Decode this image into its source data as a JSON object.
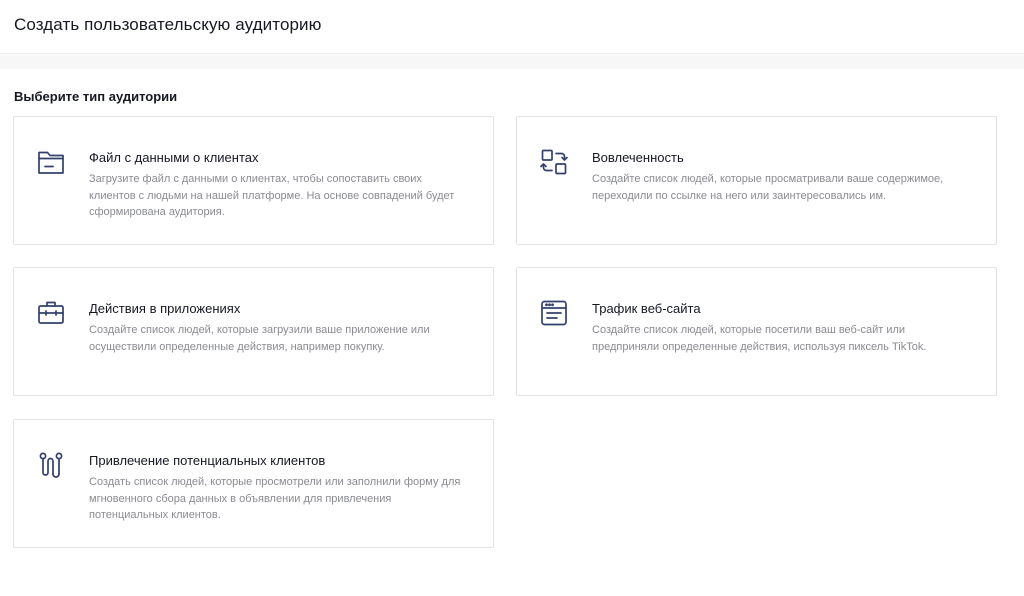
{
  "header": {
    "title": "Создать пользовательскую аудиторию"
  },
  "section": {
    "label": "Выберите тип аудитории"
  },
  "cards": [
    {
      "icon": "folder-icon",
      "title": "Файл с данными о клиентах",
      "description": "Загрузите файл с данными о клиентах, чтобы сопоставить своих клиентов с людьми на нашей платформе. На основе совпадений будет сформирована аудитория."
    },
    {
      "icon": "engagement-icon",
      "title": "Вовлеченность",
      "description": "Создайте список людей, которые просматривали ваше содержимое, переходили по ссылке на него или заинтересовались им."
    },
    {
      "icon": "briefcase-icon",
      "title": "Действия в приложениях",
      "description": "Создайте список людей, которые загрузили ваше приложение или осуществили определенные действия, например покупку."
    },
    {
      "icon": "browser-window-icon",
      "title": "Трафик веб-сайта",
      "description": "Создайте список людей, которые посетили ваш веб-сайт или предприняли определенные действия, используя пиксель TikTok."
    },
    {
      "icon": "lead-path-icon",
      "title": "Привлечение потенциальных клиентов",
      "description": "Создать список людей, которые просмотрели или заполнили форму для мгновенного сбора данных в объявлении для привлечения потенциальных клиентов."
    }
  ],
  "colors": {
    "icon_stroke": "#33406b",
    "title_text": "#161823",
    "description_text": "#8a8b91",
    "card_border": "#e3e3e6"
  }
}
